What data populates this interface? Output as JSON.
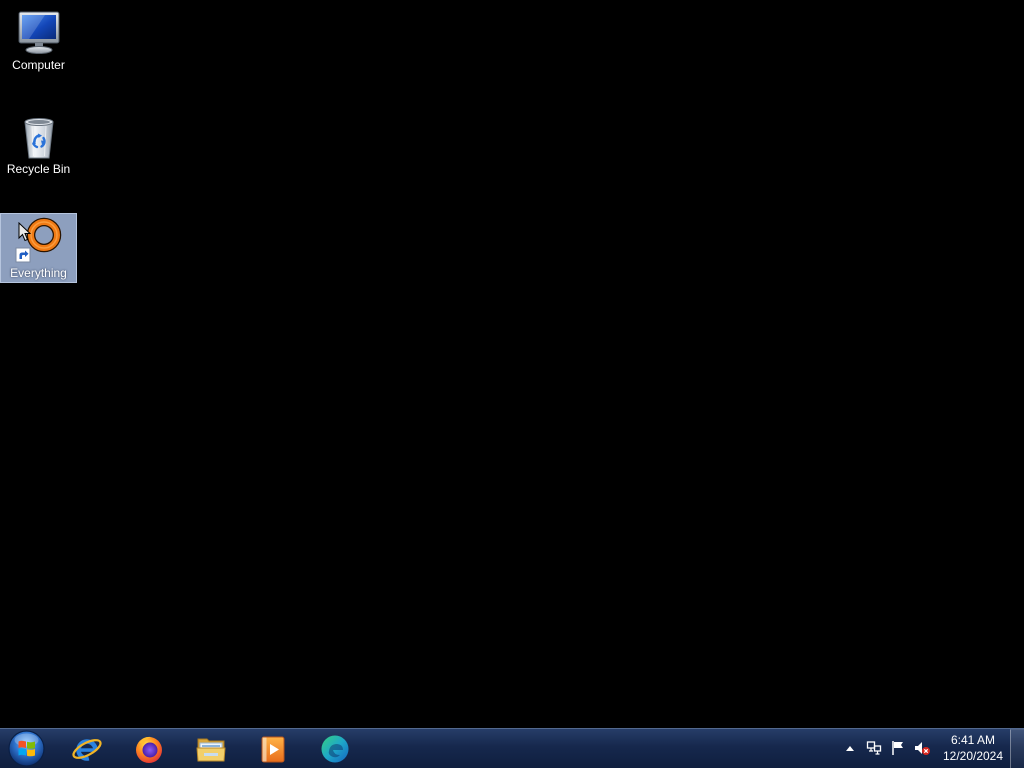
{
  "desktop": {
    "icons": [
      {
        "label": "Computer",
        "icon": "computer-icon",
        "selected": false
      },
      {
        "label": "Recycle Bin",
        "icon": "recycle-bin-icon",
        "selected": false
      },
      {
        "label": "Everything",
        "icon": "everything-icon",
        "selected": true,
        "shortcut": true
      }
    ]
  },
  "taskbar": {
    "start_button": {
      "icon": "windows-start-orb-icon"
    },
    "pinned_apps": [
      {
        "icon": "internet-explorer-icon"
      },
      {
        "icon": "firefox-icon"
      },
      {
        "icon": "windows-explorer-icon"
      },
      {
        "icon": "media-player-icon"
      },
      {
        "icon": "edge-icon"
      }
    ],
    "tray": {
      "icons": [
        "show-hidden-icons-icon",
        "network-icon",
        "action-center-flag-icon",
        "volume-muted-icon"
      ],
      "clock": {
        "time": "6:41 AM",
        "date": "12/20/2024"
      }
    },
    "show_desktop": {
      "icon": "show-desktop-icon"
    }
  },
  "colors": {
    "desktop_background": "#000000",
    "taskbar": "#16284d",
    "selection_highlight": "#8d9fbe",
    "label_text": "#ffffff"
  }
}
